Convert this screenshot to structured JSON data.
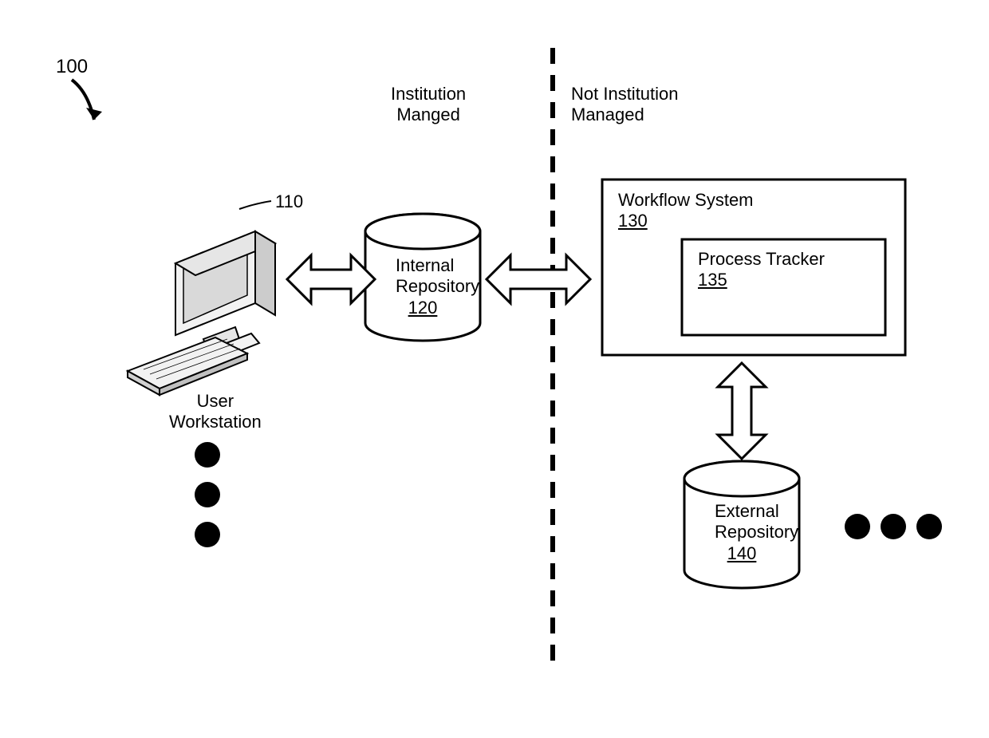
{
  "figure_number": "100",
  "zones": {
    "left_heading_line1": "Institution",
    "left_heading_line2": "Manged",
    "right_heading_line1": "Not Institution",
    "right_heading_line2": "Managed"
  },
  "workstation": {
    "ref": "110",
    "caption_line1": "User",
    "caption_line2": "Workstation"
  },
  "internal_repo": {
    "label_line1": "Internal",
    "label_line2": "Repository",
    "ref": "120"
  },
  "workflow_system": {
    "label": "Workflow System",
    "ref": "130"
  },
  "process_tracker": {
    "label": "Process Tracker",
    "ref": "135"
  },
  "external_repo": {
    "label_line1": "External",
    "label_line2": "Repository",
    "ref": "140"
  }
}
